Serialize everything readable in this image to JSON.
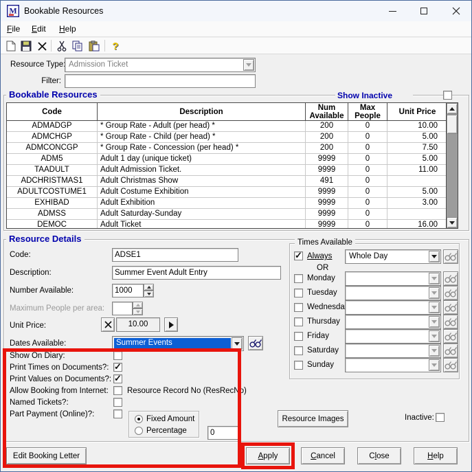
{
  "window": {
    "title": "Bookable Resources"
  },
  "menu": {
    "items": [
      {
        "label": "File",
        "u": 0
      },
      {
        "label": "Edit",
        "u": 0
      },
      {
        "label": "Help",
        "u": 0
      }
    ]
  },
  "toolbar": {
    "icons": [
      "new-document",
      "save",
      "delete",
      "cut",
      "copy",
      "paste",
      "help"
    ]
  },
  "filters": {
    "resource_type_label": "Resource Type:",
    "resource_type_value": "Admission Ticket",
    "filter_label": "Filter:",
    "filter_value": ""
  },
  "resources": {
    "title": "Bookable Resources",
    "show_inactive": {
      "label": "Show Inactive",
      "checked": false
    },
    "table": {
      "columns": [
        "Code",
        "Description",
        "Num\nAvailable",
        "Max\nPeople",
        "Unit Price"
      ],
      "rows": [
        [
          "ADMADGP",
          "* Group Rate - Adult (per head) *",
          "200",
          "0",
          "10.00"
        ],
        [
          "ADMCHGP",
          "* Group Rate - Child (per head) *",
          "200",
          "0",
          "5.00"
        ],
        [
          "ADMCONCGP",
          "* Group Rate - Concession (per head) *",
          "200",
          "0",
          "7.50"
        ],
        [
          "ADM5",
          "Adult 1 day (unique ticket)",
          "9999",
          "0",
          "5.00"
        ],
        [
          "TAADULT",
          "Adult Admission Ticket.",
          "9999",
          "0",
          "11.00"
        ],
        [
          "ADCHRISTMAS1",
          "Adult Christmas Show",
          "491",
          "0",
          ""
        ],
        [
          "ADULTCOSTUME1",
          "Adult Costume Exhibition",
          "9999",
          "0",
          "5.00"
        ],
        [
          "EXHIBAD",
          "Adult Exhibition",
          "9999",
          "0",
          "3.00"
        ],
        [
          "ADMSS",
          "Adult Saturday-Sunday",
          "9999",
          "0",
          ""
        ],
        [
          "DEMOC",
          "Adult Ticket",
          "9999",
          "0",
          "16.00"
        ]
      ]
    }
  },
  "details": {
    "title": "Resource Details",
    "code_label": "Code:",
    "code_value": "ADSE1",
    "description_label": "Description:",
    "description_value": "Summer Event Adult Entry",
    "number_available_label": "Number Available:",
    "number_available_value": "1000",
    "max_people_label": "Maximum People per area:",
    "max_people_value": "",
    "unit_price_label": "Unit Price:",
    "unit_price_value": "10.00",
    "dates_available_label": "Dates Available:",
    "dates_available_value": "Summer Events",
    "checkboxes": [
      {
        "label": "Show On Diary:",
        "checked": false
      },
      {
        "label": "Print Times on Documents?:",
        "checked": true
      },
      {
        "label": "Print Values on Documents?:",
        "checked": true
      },
      {
        "label": "Allow Booking from Internet:",
        "checked": false,
        "suffix": "Resource Record No (ResRecNo)"
      },
      {
        "label": "Named Tickets?:",
        "checked": false
      },
      {
        "label": "Part Payment (Online)?:",
        "checked": false
      }
    ],
    "part_payment": {
      "fixed_amount": {
        "label": "Fixed Amount",
        "checked": true
      },
      "percentage": {
        "label": "Percentage",
        "checked": false
      },
      "amount_value": "0"
    },
    "times": {
      "title": "Times Available",
      "always": {
        "label": "Always",
        "checked": true,
        "value": "Whole Day"
      },
      "or_label": "OR",
      "days": [
        {
          "label": "Monday",
          "checked": false,
          "value": ""
        },
        {
          "label": "Tuesday",
          "checked": false,
          "value": ""
        },
        {
          "label": "Wednesday",
          "checked": false,
          "value": ""
        },
        {
          "label": "Thursday",
          "checked": false,
          "value": ""
        },
        {
          "label": "Friday",
          "checked": false,
          "value": ""
        },
        {
          "label": "Saturday",
          "checked": false,
          "value": ""
        },
        {
          "label": "Sunday",
          "checked": false,
          "value": ""
        }
      ]
    },
    "resource_images_label": "Resource Images",
    "inactive_label": "Inactive:",
    "inactive_checked": false
  },
  "footer": {
    "edit_booking_letter": "Edit Booking Letter",
    "apply": {
      "label": "Apply",
      "u": 0
    },
    "cancel": {
      "label": "Cancel",
      "u": 0
    },
    "close": {
      "label": "Close",
      "u": 1
    },
    "help": {
      "label": "Help",
      "u": 0
    }
  },
  "colors": {
    "accent_navy": "#0202ad",
    "selection_blue": "#0c5fd4",
    "annotation_red": "#e8140c"
  }
}
